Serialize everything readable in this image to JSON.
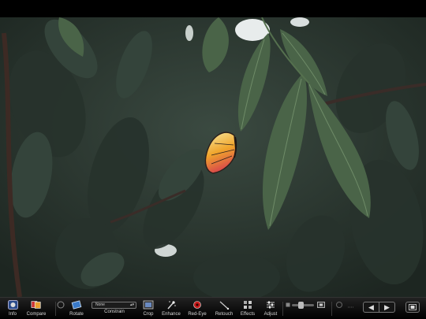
{
  "toolbar": {
    "info_label": "Info",
    "compare_label": "Compare",
    "rotate_label": "Rotate",
    "constrain_label": "Constrain",
    "constrain_value": "None",
    "crop_label": "Crop",
    "enhance_label": "Enhance",
    "redeye_label": "Red-Eye",
    "retouch_label": "Retouch",
    "effects_label": "Effects",
    "adjust_label": "Adjust",
    "zoom_level": 0.4
  },
  "colors": {
    "toolbar_bg": "#0c0c0c",
    "label_text": "#d8d8d8",
    "leaf_dark": "#2a3630",
    "leaf_light": "#4f6e4e",
    "butterfly_orange": "#e79a2a"
  },
  "icons": {
    "info": "info-icon",
    "compare": "compare-icon",
    "rotate": "rotate-icon",
    "crop": "crop-icon",
    "enhance": "enhance-wand-icon",
    "redeye": "redeye-icon",
    "retouch": "retouch-brush-icon",
    "effects": "effects-grid-icon",
    "adjust": "adjust-sliders-icon",
    "prev": "arrow-left-icon",
    "next": "arrow-right-icon",
    "fullscreen": "fullscreen-icon"
  }
}
